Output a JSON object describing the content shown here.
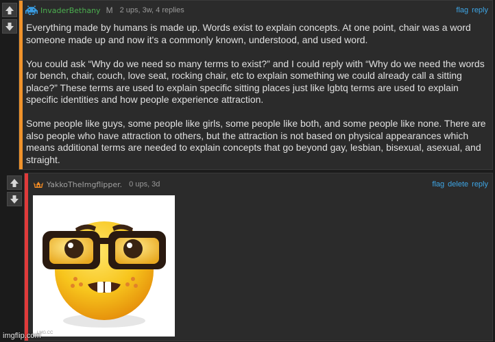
{
  "comment1": {
    "username": "InvaderBethany",
    "username_color": "#4caf50",
    "stripe_color": "#f0932b",
    "avatar_icon": "space-invader-icon",
    "badge": "M",
    "meta": "2 ups, 3w, 4 replies",
    "actions": [
      "flag",
      "reply"
    ],
    "paragraphs": [
      "Everything made by humans is made up. Words exist to explain concepts. At one point, chair was a word someone made up and now it's a commonly known, understood, and used word.",
      "You could ask “Why do we need so many terms to exist?” and I could reply with “Why do we need the words for bench, chair, couch, love seat, rocking chair, etc to explain something we could already call a sitting place?” These terms are used to explain specific sitting places just like lgbtq terms are used to explain specific identities and how people experience attraction.",
      "Some people like guys, some people like girls, some people like both, and some people like none. There are also people who have attraction to others, but the attraction is not based on physical appearances which means additional terms are needed to explain concepts that go beyond gay, lesbian, bisexual, asexual, and straight."
    ]
  },
  "comment2": {
    "username": "YakkoTheImgflipper.",
    "username_color": "#a0a0a0",
    "stripe_color": "#e03a3a",
    "avatar_icon": "crown-icon",
    "meta": "0 ups, 3d",
    "actions": [
      "flag",
      "delete",
      "reply"
    ],
    "image_icon": "nerd-face-emoji-icon",
    "image_caption": "LMG.CC"
  },
  "watermark": "imgflip.com",
  "colors": {
    "link": "#3ea6e6",
    "background": "#1b1b1b",
    "panel": "#2b2b2b"
  }
}
